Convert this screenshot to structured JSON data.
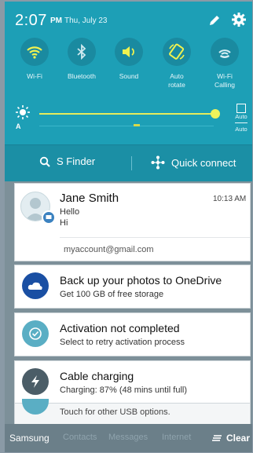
{
  "status": {
    "time": "2:07",
    "ampm": "PM",
    "date": "Thu, July 23"
  },
  "toggles": [
    {
      "label": "Wi-Fi",
      "icon": "wifi-icon"
    },
    {
      "label": "Bluetooth",
      "icon": "bluetooth-icon"
    },
    {
      "label": "Sound",
      "icon": "sound-icon"
    },
    {
      "label": "Auto\nrotate",
      "icon": "auto-rotate-icon"
    },
    {
      "label": "Wi-Fi\nCalling",
      "icon": "wifi-calling-icon"
    }
  ],
  "brightness": {
    "auto_label": "A",
    "auto_box_label_1": "Auto",
    "auto_box_label_2": "Auto"
  },
  "search_bar": {
    "sfinder": "S Finder",
    "quick_connect": "Quick connect"
  },
  "notifications": [
    {
      "title": "Jane Smith",
      "time": "10:13 AM",
      "line1": "Hello",
      "line2": "Hi",
      "account": "myaccount@gmail.com"
    },
    {
      "title": "Back up your photos to OneDrive",
      "subtitle": "Get 100 GB of free storage"
    },
    {
      "title": "Activation not completed",
      "subtitle": "Select to retry activation process"
    },
    {
      "title": "Cable charging",
      "subtitle": "Charging: 87% (48 mins until full)"
    }
  ],
  "usb_hint": "Touch for other USB options.",
  "bottom_bar": {
    "items": [
      "Samsung",
      "Contacts",
      "Messages",
      "Internet"
    ],
    "clear": "Clear"
  },
  "colors": {
    "panel": "#1d9fb6",
    "accent_yellow": "#e6eb5b",
    "onedrive": "#1a4fa3",
    "activation": "#5aaec4",
    "charging": "#4b5d67"
  }
}
